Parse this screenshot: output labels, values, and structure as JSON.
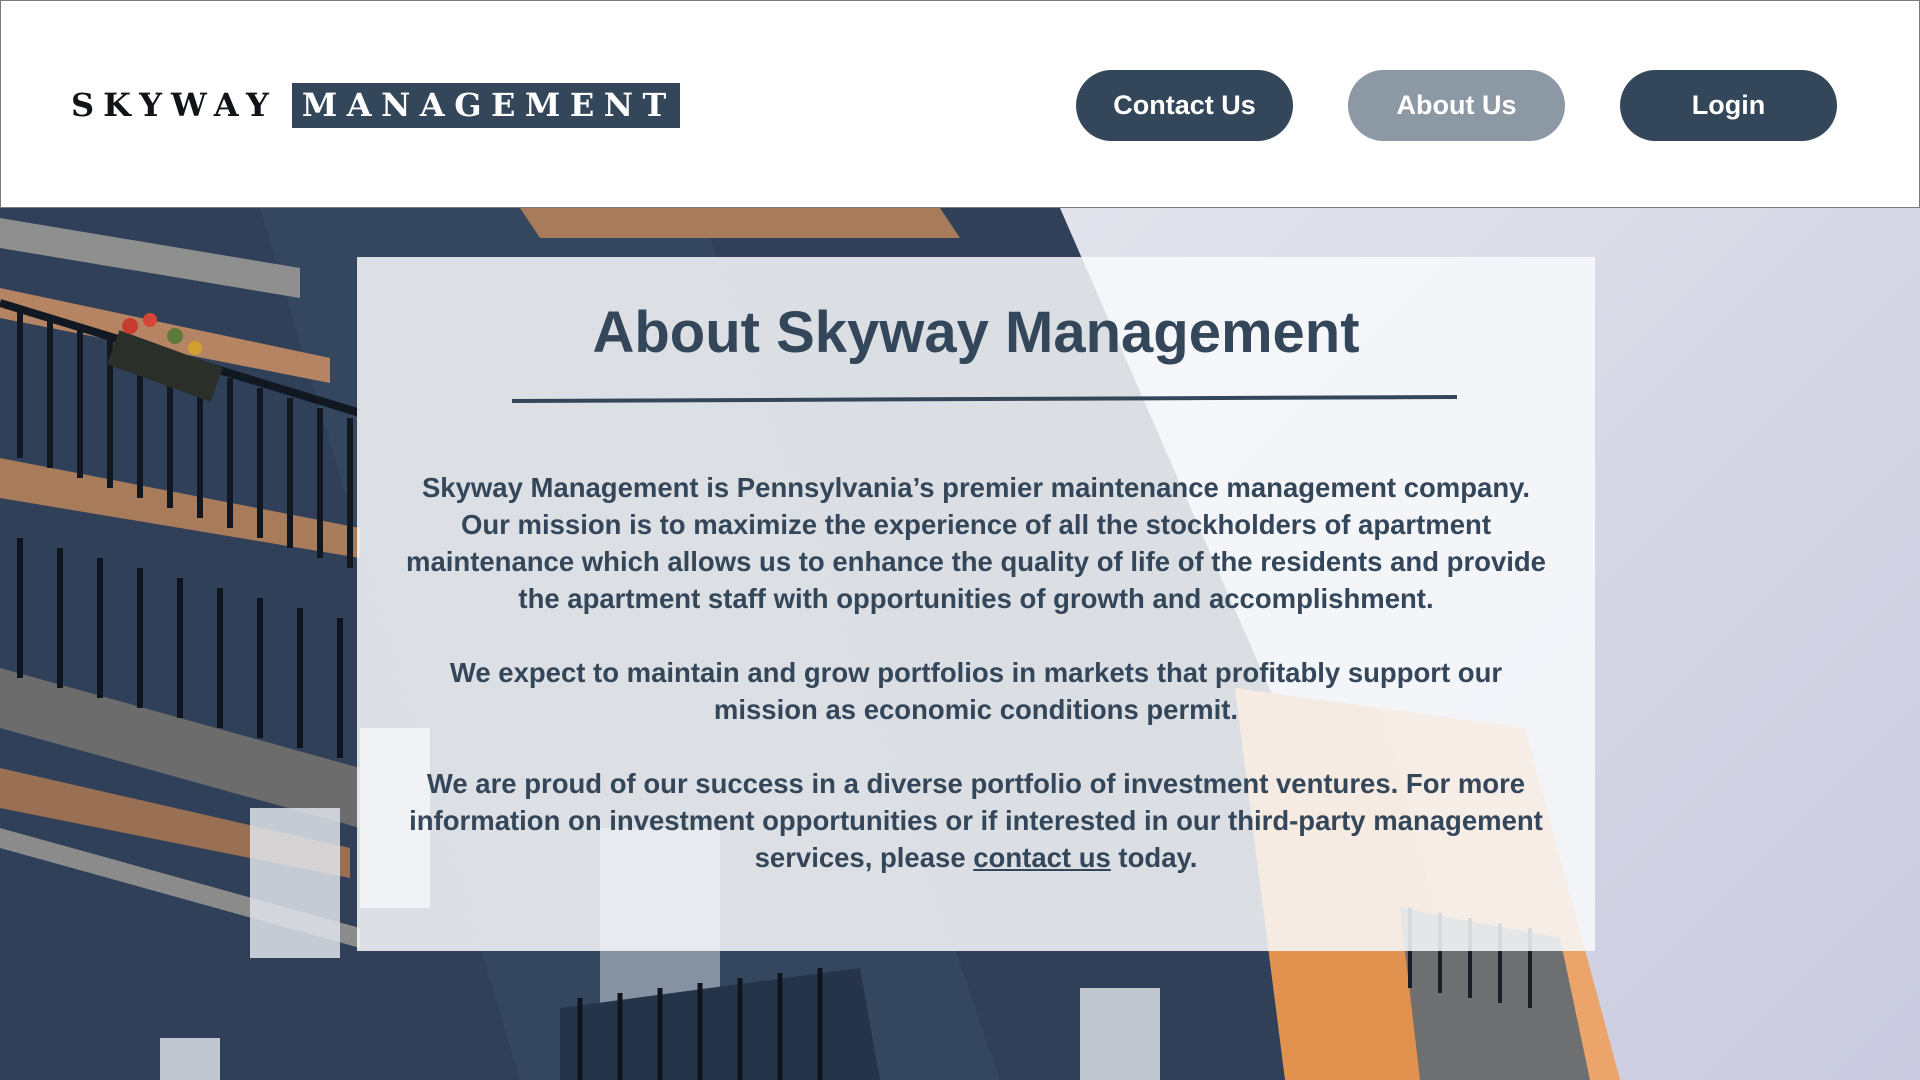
{
  "header": {
    "logo_word_1": "SKYWAY",
    "logo_word_2": "MANAGEMENT",
    "nav": {
      "contact_label": "Contact Us",
      "about_label": "About Us",
      "login_label": "Login"
    },
    "active_nav": "About Us"
  },
  "about": {
    "title": "About Skyway Management",
    "paragraph_1": "Skyway Management is Pennsylvania’s premier maintenance management company. Our mission is to maximize the experience of all the stockholders of apartment maintenance which allows us to enhance the quality of life of the residents and provide the apartment staff with opportunities of growth and accomplishment.",
    "paragraph_2": "We expect to maintain and grow portfolios in markets that profitably support our mission as economic conditions permit.",
    "paragraph_3_before_link": "We are proud of our success in a diverse portfolio of investment ventures. For more information on investment opportunities or if interested in our third-party management services, please ",
    "paragraph_3_link": "contact us",
    "paragraph_3_after_link": " today."
  },
  "colors": {
    "brand_navy": "#344659",
    "nav_active": "#8c98a3",
    "header_bg": "#ffffff",
    "card_bg": "#f8f9fb"
  },
  "background": {
    "subject": "apartment-building-balconies-photo"
  }
}
